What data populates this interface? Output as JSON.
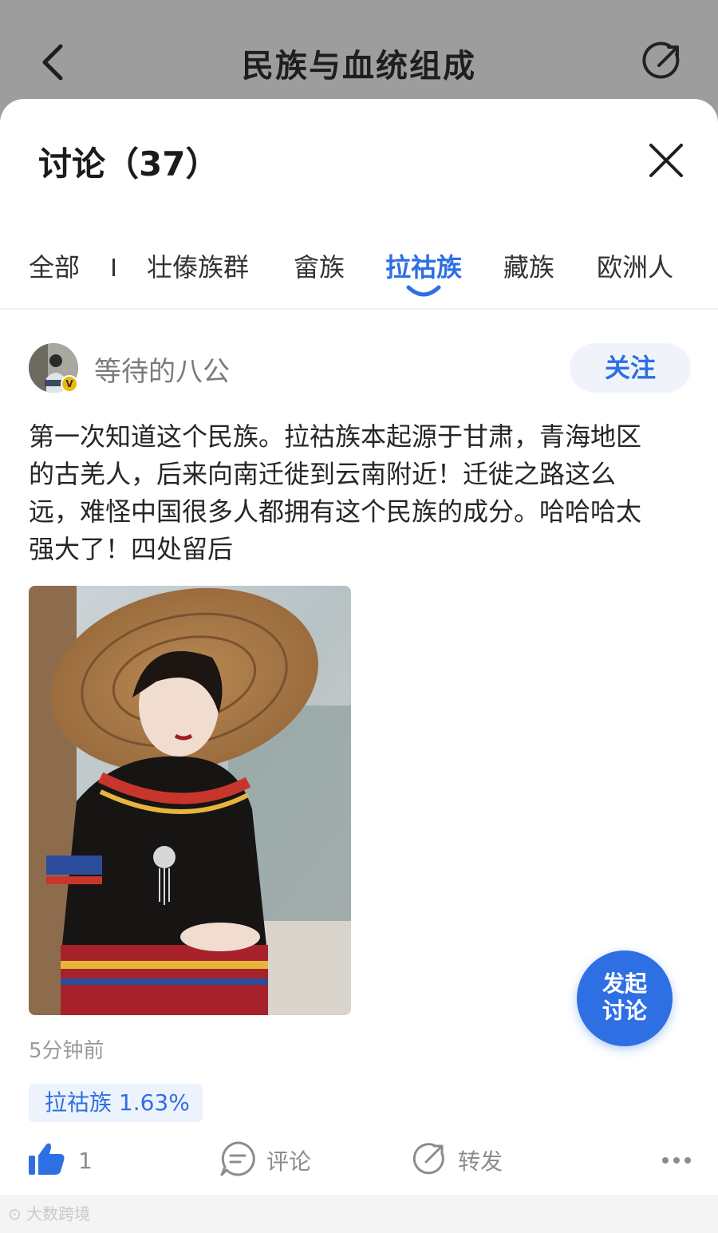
{
  "nav": {
    "title": "民族与血统组成"
  },
  "sheet": {
    "title": "讨论（37）",
    "tabs": [
      {
        "label": "全部"
      },
      {
        "label": "壮傣族群"
      },
      {
        "label": "畲族"
      },
      {
        "label": "拉祜族",
        "active": true
      },
      {
        "label": "藏族"
      },
      {
        "label": "欧洲人"
      }
    ]
  },
  "post": {
    "username": "等待的八公",
    "verified_badge": "V",
    "follow_label": "关注",
    "text_lines": [
      "第一次知道这个民族。拉祜族本起源于甘肃，青海地区",
      "的古羌人，后来向南迁徙到云南附近！迁徙之路这么",
      "远，难怪中国很多人都拥有这个民族的成分。哈哈哈太",
      "强大了！四处留后"
    ],
    "time": "5分钟前",
    "topic_chip": "拉祜族 1.63%",
    "actions": {
      "like_count": "1",
      "comment_label": "评论",
      "share_label": "转发"
    }
  },
  "fab": {
    "line1": "发起",
    "line2": "讨论"
  },
  "watermark": "大数跨境",
  "colors": {
    "accent": "#2f6fe4",
    "topbar": "#9d9d9d",
    "chip_bg": "#edf3fd"
  }
}
